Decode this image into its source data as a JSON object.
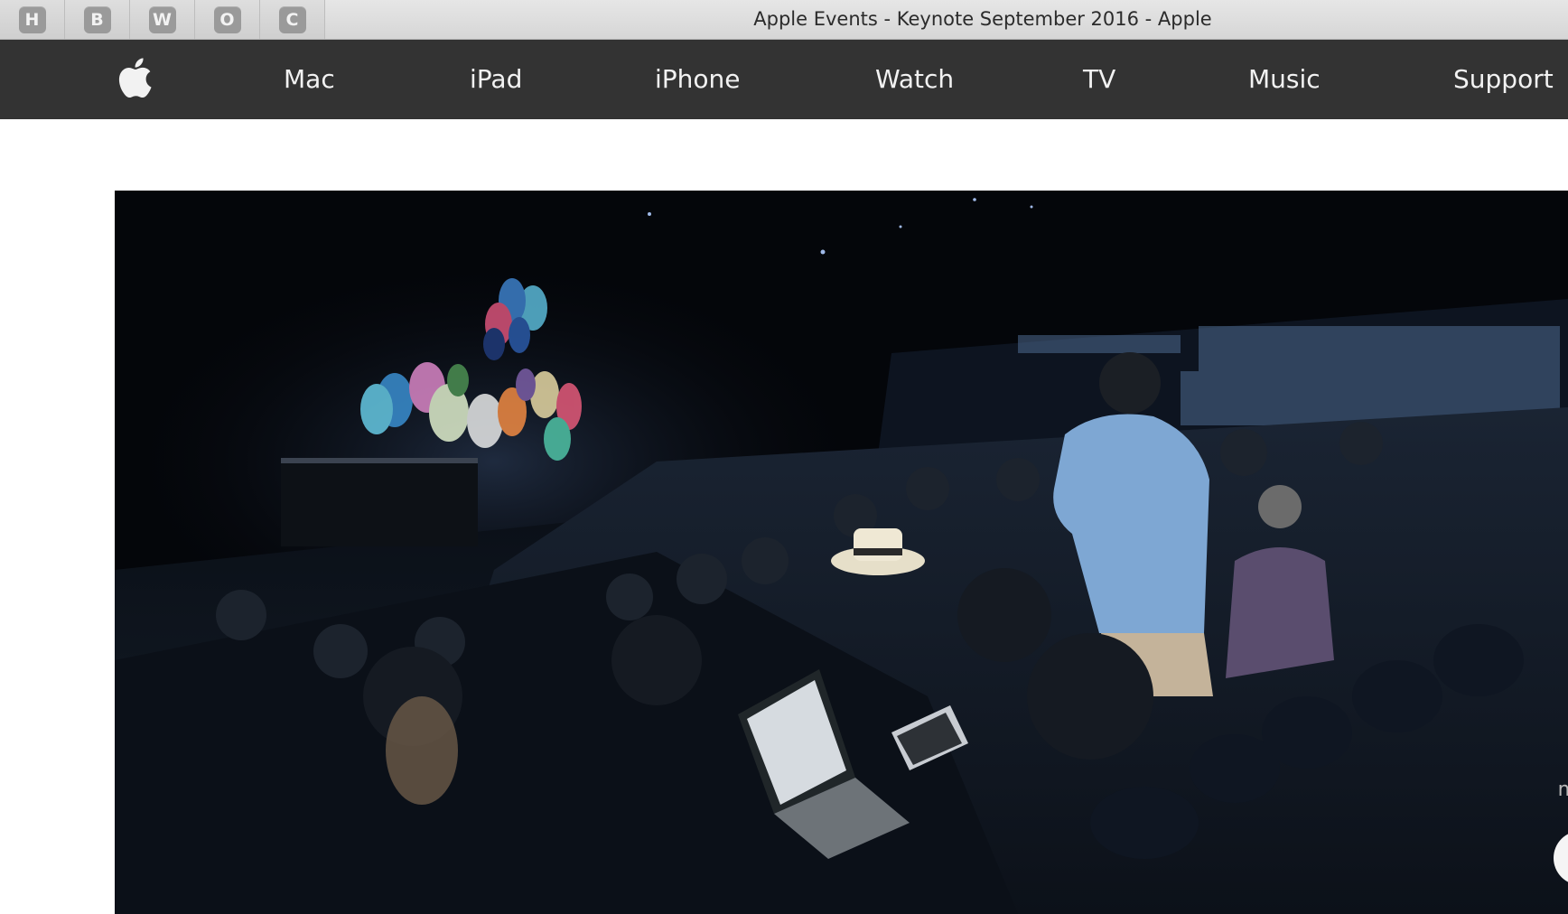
{
  "window": {
    "title": "Apple Events - Keynote September 2016 - Apple"
  },
  "bookmarks": [
    {
      "letter": "H"
    },
    {
      "letter": "B"
    },
    {
      "letter": "W"
    },
    {
      "letter": "O"
    },
    {
      "letter": "C"
    }
  ],
  "globalnav": {
    "logo_icon": "apple-logo-icon",
    "items": [
      {
        "label": "Mac"
      },
      {
        "label": "iPad"
      },
      {
        "label": "iPhone"
      },
      {
        "label": "Watch"
      },
      {
        "label": "TV"
      },
      {
        "label": "Music"
      },
      {
        "label": "Support"
      }
    ]
  },
  "video": {
    "side_text": "m"
  },
  "colors": {
    "nav_background": "#333333",
    "nav_text": "#f2f2f2",
    "titlebar": "#d6d6d6",
    "bookmark_glyph": "#9a9a9a"
  }
}
